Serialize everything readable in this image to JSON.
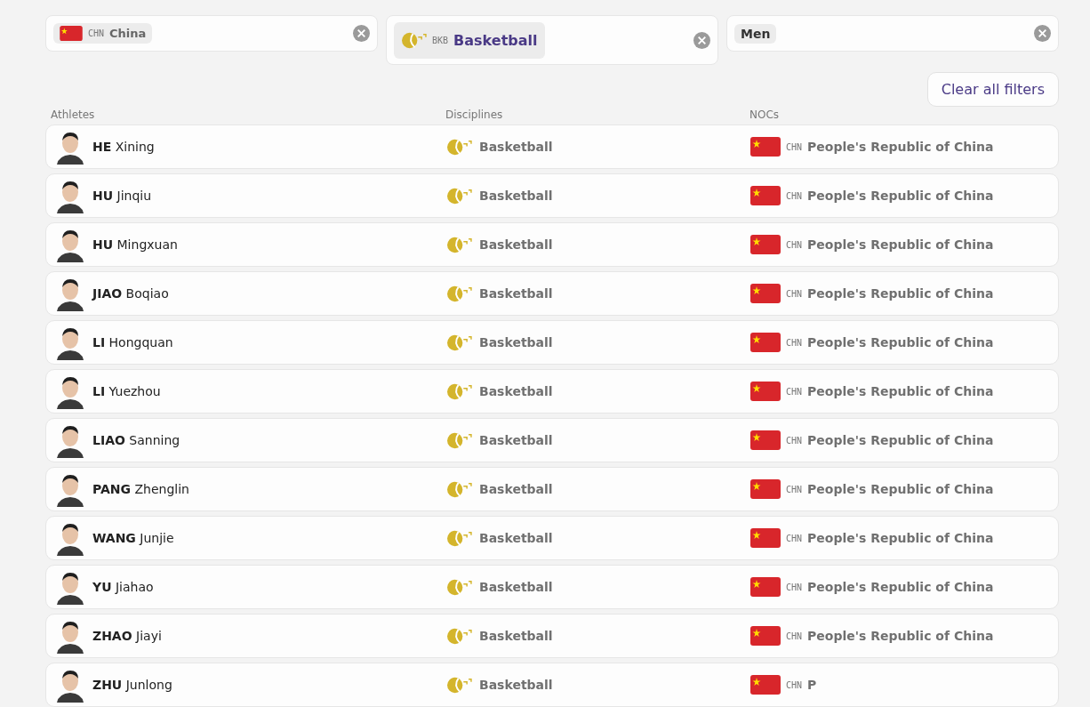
{
  "filters": [
    {
      "kind": "noc",
      "code": "CHN",
      "label": "China"
    },
    {
      "kind": "discipline",
      "code": "BKB",
      "label": "Basketball"
    },
    {
      "kind": "plain",
      "label": "Men"
    }
  ],
  "clear_button": "Clear all filters",
  "columns": [
    "Athletes",
    "Disciplines",
    "NOCs"
  ],
  "rows": [
    {
      "athlete": "**HE** Xining",
      "discipline": "Basketball",
      "noc_code": "CHN",
      "noc": "People's Republic of China"
    },
    {
      "athlete": "**HU** Jinqiu",
      "discipline": "Basketball",
      "noc_code": "CHN",
      "noc": "People's Republic of China"
    },
    {
      "athlete": "**HU** Mingxuan",
      "discipline": "Basketball",
      "noc_code": "CHN",
      "noc": "People's Republic of China"
    },
    {
      "athlete": "**JIAO** Boqiao",
      "discipline": "Basketball",
      "noc_code": "CHN",
      "noc": "People's Republic of China"
    },
    {
      "athlete": "**LI** Hongquan",
      "discipline": "Basketball",
      "noc_code": "CHN",
      "noc": "People's Republic of China"
    },
    {
      "athlete": "**LI** Yuezhou",
      "discipline": "Basketball",
      "noc_code": "CHN",
      "noc": "People's Republic of China"
    },
    {
      "athlete": "**LIAO** Sanning",
      "discipline": "Basketball",
      "noc_code": "CHN",
      "noc": "People's Republic of China"
    },
    {
      "athlete": "**PANG** Zhenglin",
      "discipline": "Basketball",
      "noc_code": "CHN",
      "noc": "People's Republic of China"
    },
    {
      "athlete": "**WANG** Junjie",
      "discipline": "Basketball",
      "noc_code": "CHN",
      "noc": "People's Republic of China"
    },
    {
      "athlete": "**YU** Jiahao",
      "discipline": "Basketball",
      "noc_code": "CHN",
      "noc": "People's Republic of China"
    },
    {
      "athlete": "**ZHAO** Jiayi",
      "discipline": "Basketball",
      "noc_code": "CHN",
      "noc": "People's Republic of China"
    },
    {
      "athlete": "**ZHU** Junlong",
      "discipline": "Basketball",
      "noc_code": "CHN",
      "noc": "P"
    }
  ]
}
